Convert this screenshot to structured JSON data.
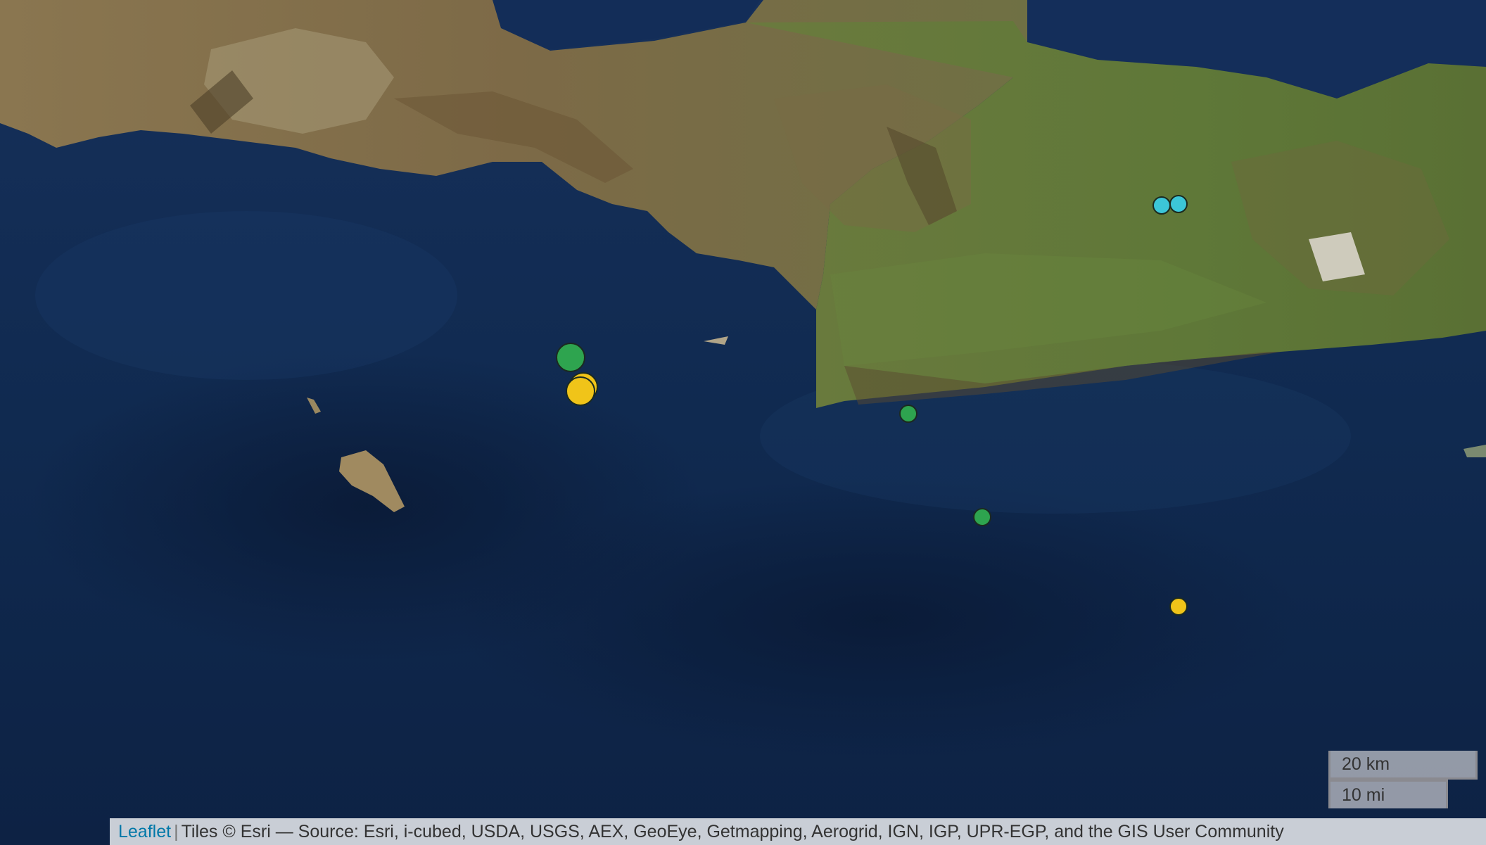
{
  "map": {
    "layer": "satellite imagery",
    "markers": [
      {
        "id": "m1",
        "color": "#2ea44f",
        "size": "large"
      },
      {
        "id": "m2",
        "color": "#f0c419",
        "size": "large"
      },
      {
        "id": "m3",
        "color": "#f0c419",
        "size": "large"
      },
      {
        "id": "m4",
        "color": "#2ea44f",
        "size": "small"
      },
      {
        "id": "m5",
        "color": "#2ea44f",
        "size": "small"
      },
      {
        "id": "m6",
        "color": "#f0c419",
        "size": "small"
      },
      {
        "id": "m7",
        "color": "#3cc6d8",
        "size": "small"
      },
      {
        "id": "m8",
        "color": "#3cc6d8",
        "size": "small"
      }
    ]
  },
  "scale": {
    "km": "20 km",
    "mi": "10 mi"
  },
  "attribution": {
    "leaflet": "Leaflet",
    "separator": "|",
    "text": "Tiles © Esri — Source: Esri, i-cubed, USDA, USGS, AEX, GeoEye, Getmapping, Aerogrid, IGN, IGP, UPR-EGP, and the GIS User Community"
  }
}
